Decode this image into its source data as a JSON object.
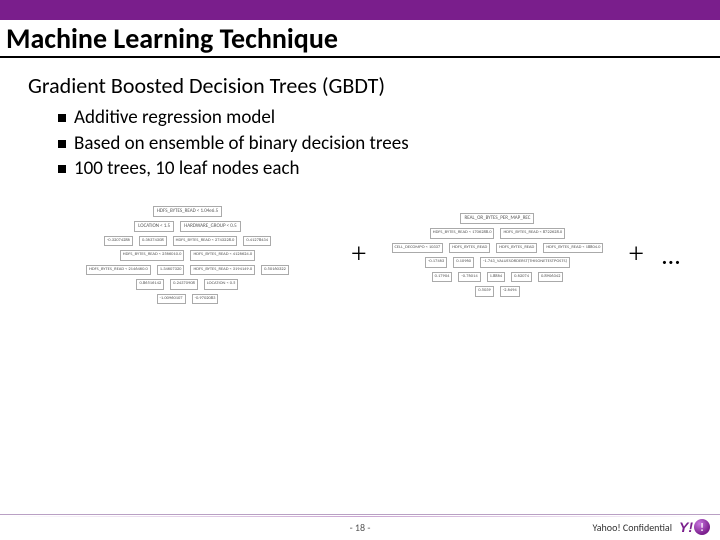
{
  "header": {
    "title": "Machine Learning Technique"
  },
  "subtitle": "Gradient Boosted Decision Trees (GBDT)",
  "bullets": [
    "Additive regression model",
    "Based on ensemble of binary decision trees",
    "100 trees, 10 leaf nodes each"
  ],
  "diagram": {
    "plus": "+",
    "ellipsis": "…",
    "tree1": {
      "r0": [
        "HDFS_BYTES_READ < 1.04e6.5"
      ],
      "r1": [
        "LOCATION < 1.5",
        "HARDWARE_GROUP < 0.5"
      ],
      "r2": [
        "-0.32074286",
        "0.36374308",
        "HDFS_BYTES_READ < 2743228.0",
        "0.41278434"
      ],
      "r3": [
        "HDFS_BYTES_READ < 2566010.0",
        "HDFS_BYTES_READ < 4126624.0"
      ],
      "r4": [
        "HDFS_BYTES_READ < 2146460.0",
        "1.34607320",
        "HDFS_BYTES_READ < 3194149.0",
        "0.50160322"
      ],
      "r5": [
        "0.86516142",
        "0.24370908",
        "LOCATION < 0.5"
      ],
      "r6": [
        "-1.00960107",
        "-0.9702083"
      ]
    },
    "tree2": {
      "r0": [
        "REAL_OR_BYTES_PER_MAP_REC"
      ],
      "r1": [
        "HDFS_BYTES_READ < 1706288.0",
        "HDFS_BYTES_READ < 8722628.0"
      ],
      "r2": [
        "CELL_DECOMPO < 10337",
        "HDFS_BYTES_READ",
        "HDFS_BYTES_READ",
        "HDFS_BYTES_READ < 18804.0"
      ],
      "r3": [
        "-0.17463",
        "0.10960",
        "-1.743_VALUESORDERST(THISONETESTPOSTS)"
      ],
      "r4": [
        "0.17904",
        "-0.76014",
        "1.8864",
        "0.62074",
        "0.8906342"
      ],
      "r5": [
        "0.5039",
        "-2.6494"
      ]
    }
  },
  "footer": {
    "page": "- 18 -",
    "confidential": "Yahoo! Confidential",
    "logo_text": "Y!",
    "logo_bang": "!"
  }
}
